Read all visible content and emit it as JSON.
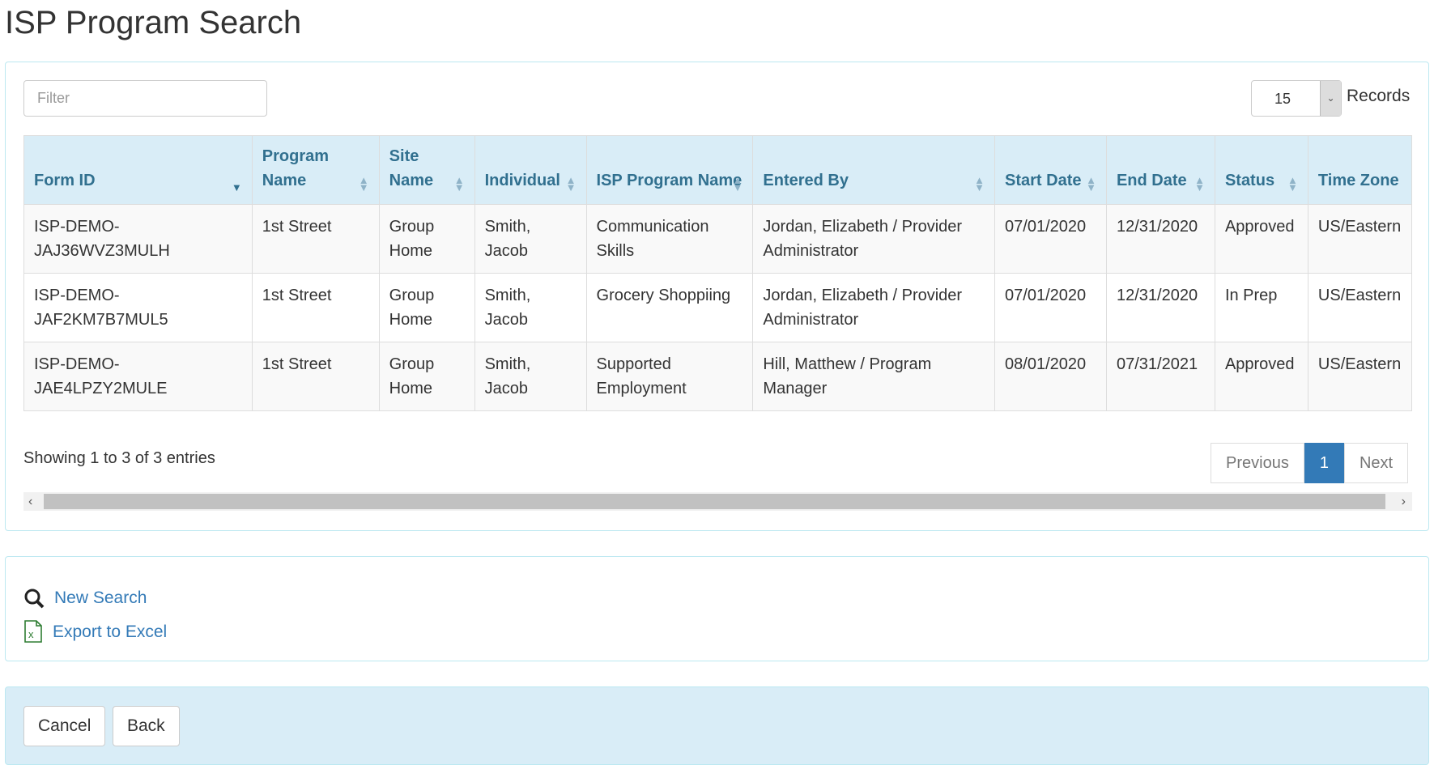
{
  "title": "ISP Program Search",
  "filter": {
    "placeholder": "Filter",
    "value": ""
  },
  "records": {
    "value": "15",
    "label": "Records"
  },
  "table": {
    "columns": [
      "Form ID",
      "Program Name",
      "Site Name",
      "Individual",
      "ISP Program Name",
      "Entered By",
      "Start Date",
      "End Date",
      "Status",
      "Time Zone"
    ],
    "rows": [
      [
        "ISP-DEMO-JAJ36WVZ3MULH",
        "1st Street",
        "Group Home",
        "Smith, Jacob",
        "Communication Skills",
        "Jordan, Elizabeth / Provider Administrator",
        "07/01/2020",
        "12/31/2020",
        "Approved",
        "US/Eastern"
      ],
      [
        "ISP-DEMO-JAF2KM7B7MUL5",
        "1st Street",
        "Group Home",
        "Smith, Jacob",
        "Grocery Shoppiing",
        "Jordan, Elizabeth / Provider Administrator",
        "07/01/2020",
        "12/31/2020",
        "In Prep",
        "US/Eastern"
      ],
      [
        "ISP-DEMO-JAE4LPZY2MULE",
        "1st Street",
        "Group Home",
        "Smith, Jacob",
        "Supported Employment",
        "Hill, Matthew / Program Manager",
        "08/01/2020",
        "07/31/2021",
        "Approved",
        "US/Eastern"
      ]
    ]
  },
  "info": "Showing 1 to 3 of 3 entries",
  "pagination": {
    "previous": "Previous",
    "current": "1",
    "next": "Next"
  },
  "actions": {
    "new_search": "New Search",
    "export": "Export to Excel"
  },
  "buttons": {
    "cancel": "Cancel",
    "back": "Back"
  },
  "colors": {
    "header_bg": "#d9edf7",
    "header_text": "#31708f",
    "link": "#337ab7",
    "active_page": "#337ab7"
  }
}
